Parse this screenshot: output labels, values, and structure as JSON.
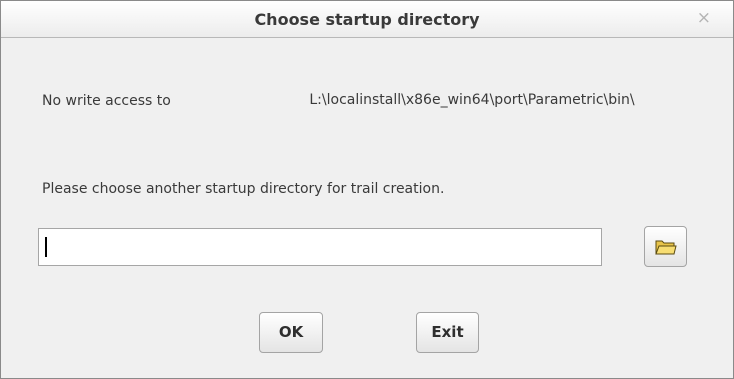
{
  "dialog": {
    "title": "Choose startup directory",
    "close_glyph": "×",
    "no_write_label": "No write access to",
    "path": "L:\\localinstall\\x86e_win64\\port\\Parametric\\bin\\",
    "instruction": "Please choose another startup directory for trail creation.",
    "directory_input": {
      "value": "",
      "placeholder": ""
    },
    "browse_icon": "folder-icon",
    "ok_label": "OK",
    "exit_label": "Exit"
  }
}
